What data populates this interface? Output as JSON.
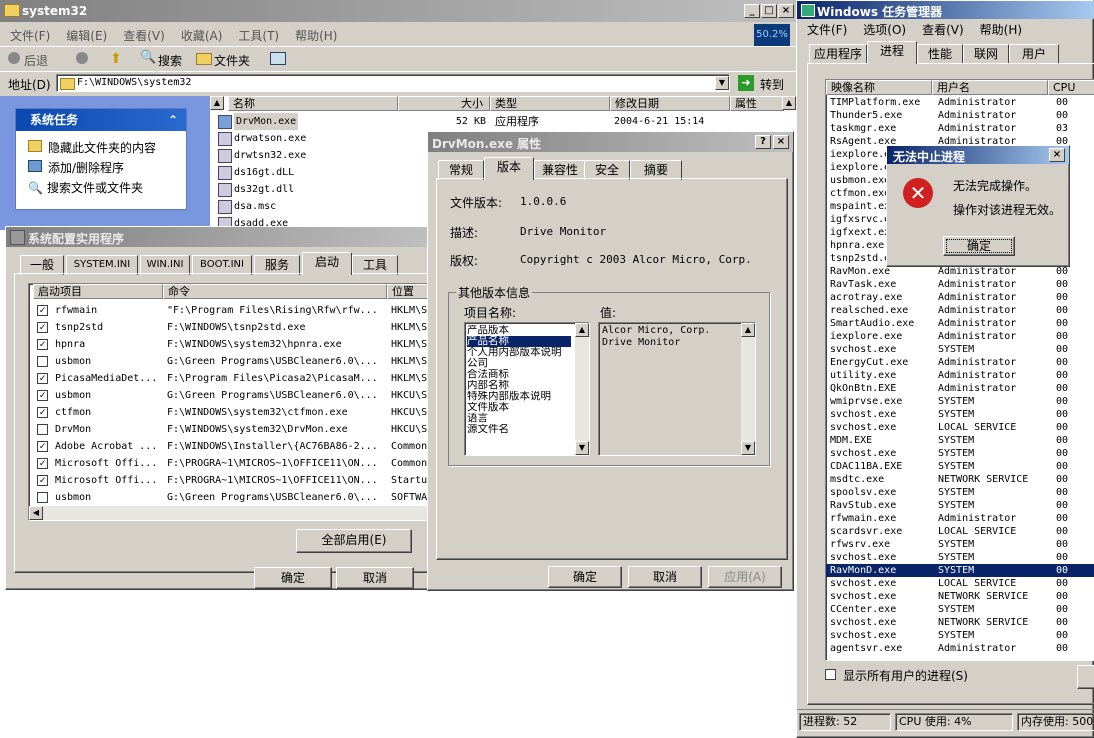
{
  "explorer": {
    "title": "system32",
    "menu": [
      "文件(F)",
      "编辑(E)",
      "查看(V)",
      "收藏(A)",
      "工具(T)",
      "帮助(H)"
    ],
    "cpu_badge": "50.2%",
    "toolbar": {
      "back": "后退",
      "search": "搜索",
      "folders": "文件夹"
    },
    "address_label": "地址(D)",
    "address_value": "F:\\WINDOWS\\system32",
    "go": "转到",
    "tasks_title": "系统任务",
    "tasks": [
      "隐藏此文件夹的内容",
      "添加/删除程序",
      "搜索文件或文件夹"
    ],
    "columns": [
      "名称",
      "大小",
      "类型",
      "修改日期",
      "属性"
    ],
    "files": [
      {
        "name": "DrvMon.exe",
        "size": "52 KB",
        "type": "应用程序",
        "date": "2004-6-21 15:14"
      },
      {
        "name": "drwatson.exe",
        "size": "",
        "type": "",
        "date": ""
      },
      {
        "name": "drwtsn32.exe",
        "size": "",
        "type": "",
        "date": ""
      },
      {
        "name": "ds16gt.dLL",
        "size": "",
        "type": "",
        "date": ""
      },
      {
        "name": "ds32gt.dll",
        "size": "",
        "type": "",
        "date": ""
      },
      {
        "name": "dsa.msc",
        "size": "",
        "type": "",
        "date": ""
      },
      {
        "name": "dsadd.exe",
        "size": "",
        "type": "",
        "date": ""
      }
    ]
  },
  "msconfig": {
    "title": "系统配置实用程序",
    "tabs": [
      "一般",
      "SYSTEM.INI",
      "WIN.INI",
      "BOOT.INI",
      "服务",
      "启动",
      "工具"
    ],
    "columns": [
      "启动项目",
      "命令",
      "位置"
    ],
    "items": [
      {
        "checked": true,
        "name": "rfwmain",
        "cmd": "\"F:\\Program Files\\Rising\\Rfw\\rfw...",
        "loc": "HKLM\\S"
      },
      {
        "checked": true,
        "name": "tsnp2std",
        "cmd": "F:\\WINDOWS\\tsnp2std.exe",
        "loc": "HKLM\\S"
      },
      {
        "checked": true,
        "name": "hpnra",
        "cmd": "F:\\WINDOWS\\system32\\hpnra.exe",
        "loc": "HKLM\\S"
      },
      {
        "checked": false,
        "name": "usbmon",
        "cmd": "G:\\Green Programs\\USBCleaner6.0\\...",
        "loc": "HKLM\\S"
      },
      {
        "checked": true,
        "name": "PicasaMediaDet...",
        "cmd": "F:\\Program Files\\Picasa2\\PicasaM...",
        "loc": "HKLM\\S"
      },
      {
        "checked": true,
        "name": "usbmon",
        "cmd": "G:\\Green Programs\\USBCleaner6.0\\...",
        "loc": "HKCU\\S"
      },
      {
        "checked": true,
        "name": "ctfmon",
        "cmd": "F:\\WINDOWS\\system32\\ctfmon.exe",
        "loc": "HKCU\\S"
      },
      {
        "checked": false,
        "name": "DrvMon",
        "cmd": "F:\\WINDOWS\\system32\\DrvMon.exe",
        "loc": "HKCU\\S"
      },
      {
        "checked": true,
        "name": "Adobe Acrobat ...",
        "cmd": "F:\\WINDOWS\\Installer\\{AC76BA86-2...",
        "loc": "Common"
      },
      {
        "checked": true,
        "name": "Microsoft Offi...",
        "cmd": "F:\\PROGRA~1\\MICROS~1\\OFFICE11\\ON...",
        "loc": "Common"
      },
      {
        "checked": true,
        "name": "Microsoft Offi...",
        "cmd": "F:\\PROGRA~1\\MICROS~1\\OFFICE11\\ON...",
        "loc": "Startu"
      },
      {
        "checked": false,
        "name": "usbmon",
        "cmd": "G:\\Green Programs\\USBCleaner6.0\\...",
        "loc": "SOFTWA"
      }
    ],
    "enable_all": "全部启用(E)",
    "ok": "确定",
    "cancel": "取消"
  },
  "props": {
    "title": "DrvMon.exe 属性",
    "tabs": [
      "常规",
      "版本",
      "兼容性",
      "安全",
      "摘要"
    ],
    "file_version_label": "文件版本:",
    "file_version": "1.0.0.6",
    "desc_label": "描述:",
    "desc": "Drive Monitor",
    "copyright_label": "版权:",
    "copyright": "Copyright c 2003 Alcor Micro, Corp.",
    "other_group": "其他版本信息",
    "item_label": "项目名称:",
    "value_label": "值:",
    "items": [
      "产品版本",
      "产品名称",
      "个人用内部版本说明",
      "公司",
      "合法商标",
      "内部名称",
      "特殊内部版本说明",
      "文件版本",
      "语言",
      "源文件名"
    ],
    "value_lines": [
      "Alcor Micro, Corp.",
      "Drive Monitor"
    ],
    "ok": "确定",
    "cancel": "取消",
    "apply": "应用(A)"
  },
  "taskmgr": {
    "title": "Windows 任务管理器",
    "menu": [
      "文件(F)",
      "选项(O)",
      "查看(V)",
      "帮助(H)"
    ],
    "tabs": [
      "应用程序",
      "进程",
      "性能",
      "联网",
      "用户"
    ],
    "columns": [
      "映像名称",
      "用户名",
      "CPU"
    ],
    "processes": [
      [
        "TIMPlatform.exe",
        "Administrator",
        "00"
      ],
      [
        "Thunder5.exe",
        "Administrator",
        "00"
      ],
      [
        "taskmgr.exe",
        "Administrator",
        "03"
      ],
      [
        "RsAgent.exe",
        "Administrator",
        "00"
      ],
      [
        "iexplore.exe",
        "",
        "00"
      ],
      [
        "iexplore.exe",
        "",
        "00"
      ],
      [
        "usbmon.exe",
        "",
        "00"
      ],
      [
        "ctfmon.exe",
        "",
        "00"
      ],
      [
        "mspaint.exe",
        "",
        "00"
      ],
      [
        "igfxsrvc.exe",
        "",
        "00"
      ],
      [
        "igfxext.exe",
        "",
        "00"
      ],
      [
        "hpnra.exe",
        "",
        "00"
      ],
      [
        "tsnp2std.exe",
        "",
        "00"
      ],
      [
        "RavMon.exe",
        "Administrator",
        "00"
      ],
      [
        "RavTask.exe",
        "Administrator",
        "00"
      ],
      [
        "acrotray.exe",
        "Administrator",
        "00"
      ],
      [
        "realsched.exe",
        "Administrator",
        "00"
      ],
      [
        "SmartAudio.exe",
        "Administrator",
        "00"
      ],
      [
        "iexplore.exe",
        "Administrator",
        "00"
      ],
      [
        "svchost.exe",
        "SYSTEM",
        "00"
      ],
      [
        "EnergyCut.exe",
        "Administrator",
        "00"
      ],
      [
        "utility.exe",
        "Administrator",
        "00"
      ],
      [
        "QkOnBtn.EXE",
        "Administrator",
        "00"
      ],
      [
        "wmiprvse.exe",
        "SYSTEM",
        "00"
      ],
      [
        "svchost.exe",
        "SYSTEM",
        "00"
      ],
      [
        "svchost.exe",
        "LOCAL SERVICE",
        "00"
      ],
      [
        "MDM.EXE",
        "SYSTEM",
        "00"
      ],
      [
        "svchost.exe",
        "SYSTEM",
        "00"
      ],
      [
        "CDAC11BA.EXE",
        "SYSTEM",
        "00"
      ],
      [
        "msdtc.exe",
        "NETWORK SERVICE",
        "00"
      ],
      [
        "spoolsv.exe",
        "SYSTEM",
        "00"
      ],
      [
        "RavStub.exe",
        "SYSTEM",
        "00"
      ],
      [
        "rfwmain.exe",
        "Administrator",
        "00"
      ],
      [
        "scardsvr.exe",
        "LOCAL SERVICE",
        "00"
      ],
      [
        "rfwsrv.exe",
        "SYSTEM",
        "00"
      ],
      [
        "svchost.exe",
        "SYSTEM",
        "00"
      ],
      [
        "RavMonD.exe",
        "SYSTEM",
        "00"
      ],
      [
        "svchost.exe",
        "LOCAL SERVICE",
        "00"
      ],
      [
        "svchost.exe",
        "NETWORK SERVICE",
        "00"
      ],
      [
        "CCenter.exe",
        "SYSTEM",
        "00"
      ],
      [
        "svchost.exe",
        "NETWORK SERVICE",
        "00"
      ],
      [
        "svchost.exe",
        "SYSTEM",
        "00"
      ],
      [
        "agentsvr.exe",
        "Administrator",
        "00"
      ]
    ],
    "selected_process": "RavMonD.exe",
    "show_all": "显示所有用户的进程(S)",
    "status": {
      "procs": "进程数: 52",
      "cpu": "CPU 使用: 4%",
      "mem": "内存使用: 500"
    }
  },
  "error": {
    "title": "无法中止进程",
    "line1": "无法完成操作。",
    "line2": "操作对该进程无效。",
    "ok": "确定"
  }
}
